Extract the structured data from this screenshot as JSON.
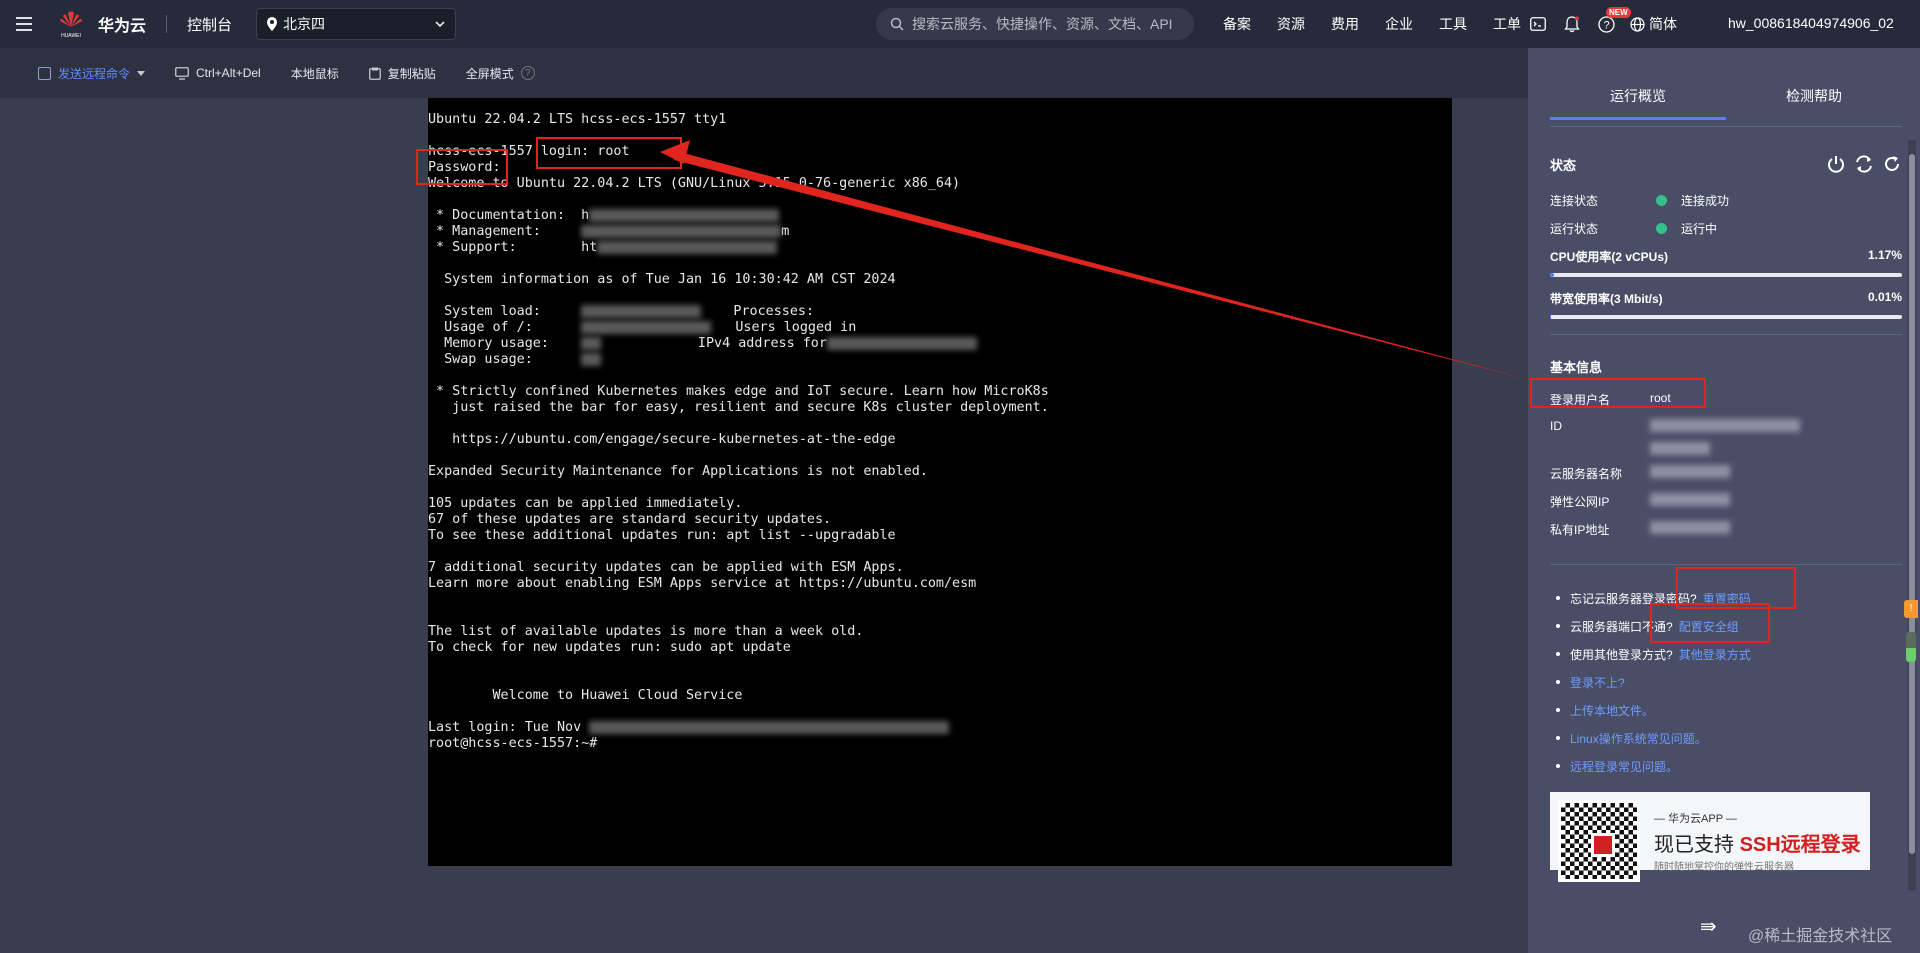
{
  "topnav": {
    "brand": "华为云",
    "logo_text": "HUAWEI",
    "console": "控制台",
    "region": "北京四",
    "search_placeholder": "搜索云服务、快捷操作、资源、文档、API",
    "links": [
      "备案",
      "资源",
      "费用",
      "企业",
      "工具",
      "工单"
    ],
    "new_badge": "NEW",
    "language": "简体",
    "user": "hw_008618404974906_02"
  },
  "toolbar": {
    "send_command": "发送远程命令",
    "ctrl_alt_del": "Ctrl+Alt+Del",
    "local_mouse": "本地鼠标",
    "copy_paste": "复制粘贴",
    "fullscreen": "全屏模式",
    "help": "?"
  },
  "terminal": {
    "lines": [
      {
        "t": "Ubuntu 22.04.2 LTS hcss-ecs-1557 tty1"
      },
      {
        "t": ""
      },
      {
        "t": "hcss-ecs-1557 login: root"
      },
      {
        "t": "Password:"
      },
      {
        "t": "Welcome to Ubuntu 22.04.2 LTS (GNU/Linux 5.15.0-76-generic x86_64)"
      },
      {
        "t": ""
      },
      {
        "t": " * Documentation:  h",
        "blur": 190
      },
      {
        "t": " * Management:     ",
        "blur": 200,
        "tail": "m"
      },
      {
        "t": " * Support:        ht",
        "blur": 180
      },
      {
        "t": ""
      },
      {
        "t": "  System information as of Tue Jan 16 10:30:42 AM CST 2024"
      },
      {
        "t": ""
      },
      {
        "t": "  System load:     ",
        "blur": 120,
        "tail": "    Processes:"
      },
      {
        "t": "  Usage of /:      ",
        "blur": 130,
        "tail": "   Users logged in"
      },
      {
        "t": "  Memory usage:    ",
        "blur": 20,
        "tail": "            IPv4 address for",
        "blur2": 150
      },
      {
        "t": "  Swap usage:      ",
        "blur": 20
      },
      {
        "t": ""
      },
      {
        "t": " * Strictly confined Kubernetes makes edge and IoT secure. Learn how MicroK8s"
      },
      {
        "t": "   just raised the bar for easy, resilient and secure K8s cluster deployment."
      },
      {
        "t": ""
      },
      {
        "t": "   https://ubuntu.com/engage/secure-kubernetes-at-the-edge"
      },
      {
        "t": ""
      },
      {
        "t": "Expanded Security Maintenance for Applications is not enabled."
      },
      {
        "t": ""
      },
      {
        "t": "105 updates can be applied immediately."
      },
      {
        "t": "67 of these updates are standard security updates."
      },
      {
        "t": "To see these additional updates run: apt list --upgradable"
      },
      {
        "t": ""
      },
      {
        "t": "7 additional security updates can be applied with ESM Apps."
      },
      {
        "t": "Learn more about enabling ESM Apps service at https://ubuntu.com/esm"
      },
      {
        "t": ""
      },
      {
        "t": ""
      },
      {
        "t": "The list of available updates is more than a week old."
      },
      {
        "t": "To check for new updates run: sudo apt update"
      },
      {
        "t": ""
      },
      {
        "t": ""
      },
      {
        "t": "        Welcome to Huawei Cloud Service"
      },
      {
        "t": ""
      },
      {
        "t": "Last login: Tue Nov ",
        "blur": 360
      },
      {
        "t": "root@hcss-ecs-1557:~#"
      }
    ]
  },
  "panel": {
    "tabs": [
      "运行概览",
      "检测帮助"
    ],
    "status": {
      "title": "状态",
      "connection_label": "连接状态",
      "connection_value": "连接成功",
      "run_label": "运行状态",
      "run_value": "运行中",
      "cpu_label": "CPU使用率(2 vCPUs)",
      "cpu_value": "1.17%",
      "cpu_fraction": 0.0117,
      "bw_label": "带宽使用率(3 Mbit/s)",
      "bw_value": "0.01%",
      "bw_fraction": 0.0001,
      "status_color": "#36c08e"
    },
    "basic": {
      "title": "基本信息",
      "login_user_label": "登录用户名",
      "login_user_value": "root",
      "id_label": "ID",
      "server_name_label": "云服务器名称",
      "eip_label": "弹性公网IP",
      "private_ip_label": "私有IP地址"
    },
    "help": [
      {
        "text": "忘记云服务器登录密码?",
        "link": "重置密码"
      },
      {
        "text": "云服务器端口不通?",
        "link": "配置安全组"
      },
      {
        "text": "使用其他登录方式?",
        "link": "其他登录方式"
      },
      {
        "text": "",
        "link": "登录不上?"
      },
      {
        "text": "",
        "link": "上传本地文件。"
      },
      {
        "text": "",
        "link": "Linux操作系统常见问题。"
      },
      {
        "text": "",
        "link": "远程登录常见问题。"
      }
    ],
    "banner": {
      "sub": "— 华为云APP —",
      "main_prefix": "现已支持 ",
      "main_highlight": "SSH远程登录",
      "foot": "随时随地掌控你的弹性云服务器"
    },
    "collapse_icon": "⇛"
  },
  "side": {
    "badge": "!"
  },
  "watermark": "@稀土掘金技术社区",
  "colors": {
    "accent": "#5b7cff",
    "annotation": "#e0241e",
    "link": "#6e9bff"
  }
}
